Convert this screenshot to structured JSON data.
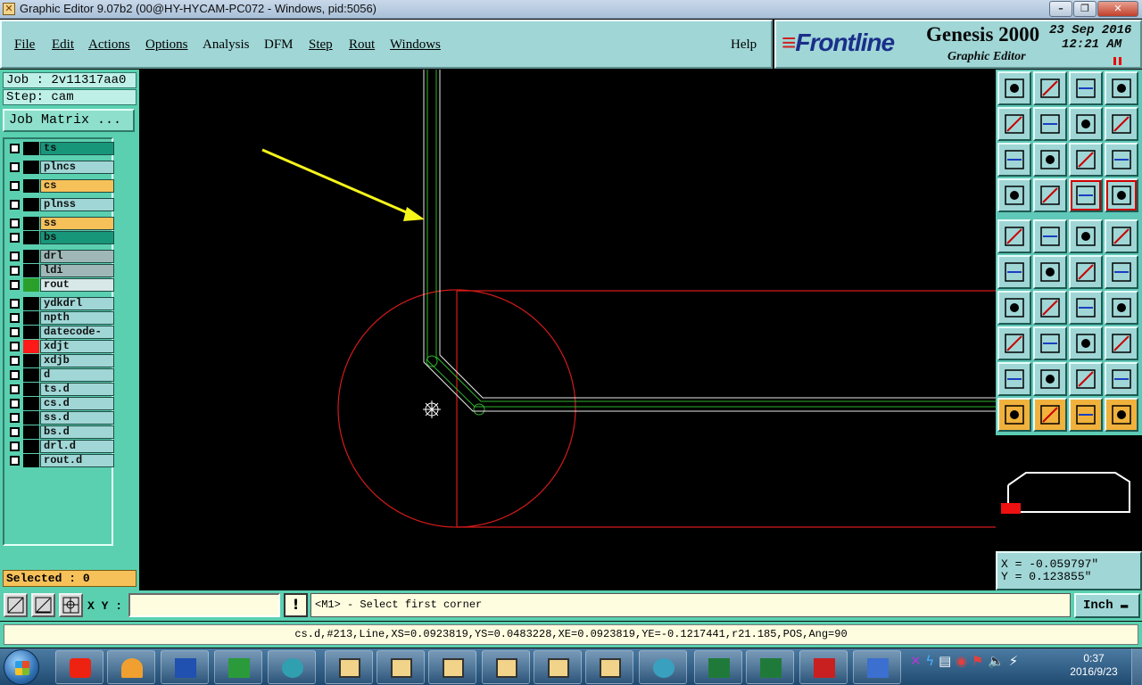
{
  "window": {
    "title": "Graphic Editor 9.07b2 (00@HY-HYCAM-PC072 - Windows, pid:5056)"
  },
  "menu": {
    "file": "File",
    "edit": "Edit",
    "actions": "Actions",
    "options": "Options",
    "analysis": "Analysis",
    "dfm": "DFM",
    "step": "Step",
    "rout": "Rout",
    "windows": "Windows",
    "help": "Help"
  },
  "brand": {
    "logo": "Frontline",
    "product": "Genesis 2000",
    "subtitle": "Graphic Editor",
    "date": "23 Sep 2016",
    "time": "12:21 AM"
  },
  "left": {
    "job": "Job : 2v11317aa0",
    "step": "Step: cam",
    "job_matrix": "Job Matrix ...",
    "selected": "Selected : 0"
  },
  "layers": [
    {
      "name": "ts",
      "color": "#17967a",
      "swatch": "#000000"
    },
    {
      "name": "plncs",
      "color": "#a0d6d6",
      "swatch": "#000000"
    },
    {
      "name": "cs",
      "color": "#f7c15a",
      "swatch": "#000000"
    },
    {
      "name": "plnss",
      "color": "#a0d6d6",
      "swatch": "#000000"
    },
    {
      "name": "ss",
      "color": "#f7c15a",
      "swatch": "#000000"
    },
    {
      "name": "bs",
      "color": "#17967a",
      "swatch": "#000000"
    },
    {
      "name": "drl",
      "color": "#9fb7b7",
      "swatch": "#000000"
    },
    {
      "name": "ldi",
      "color": "#9fb7b7",
      "swatch": "#000000"
    },
    {
      "name": "rout",
      "color": "#d8e8e8",
      "swatch": "#2aa02a"
    },
    {
      "name": "ydkdrl",
      "color": "#a0d6d6",
      "swatch": "#000000"
    },
    {
      "name": "npth",
      "color": "#a0d6d6",
      "swatch": "#000000"
    },
    {
      "name": "datecode-ts",
      "color": "#a0d6d6",
      "swatch": "#000000"
    },
    {
      "name": "xdjt",
      "color": "#a0d6d6",
      "swatch": "#ff1a1a"
    },
    {
      "name": "xdjb",
      "color": "#a0d6d6",
      "swatch": "#000000"
    },
    {
      "name": "d",
      "color": "#a0d6d6",
      "swatch": "#000000"
    },
    {
      "name": "ts.d",
      "color": "#a0d6d6",
      "swatch": "#000000"
    },
    {
      "name": "cs.d",
      "color": "#a0d6d6",
      "swatch": "#000000"
    },
    {
      "name": "ss.d",
      "color": "#a0d6d6",
      "swatch": "#000000"
    },
    {
      "name": "bs.d",
      "color": "#a0d6d6",
      "swatch": "#000000"
    },
    {
      "name": "drl.d",
      "color": "#a0d6d6",
      "swatch": "#000000"
    },
    {
      "name": "rout.d",
      "color": "#a0d6d6",
      "swatch": "#000000"
    }
  ],
  "coords": {
    "x": "X = -0.059797\"",
    "y": "Y = 0.123855\""
  },
  "command": {
    "xy_label": "X Y :",
    "xy_value": "",
    "warn": "!",
    "prompt": "<M1> - Select first corner",
    "units": "Inch"
  },
  "status": "cs.d,#213,Line,XS=0.0923819,YS=0.0483228,XE=0.0923819,YE=-0.1217441,r21.185,POS,Ang=90",
  "taskbar": {
    "clock_time": "0:37",
    "clock_date": "2016/9/23"
  },
  "colors": {
    "panel": "#5ad0b0",
    "menu": "#a0d6d6",
    "canvas": "#000000",
    "trace_red": "#d41a1a",
    "trace_green": "#2db52d",
    "arrow": "#f5f51a"
  }
}
